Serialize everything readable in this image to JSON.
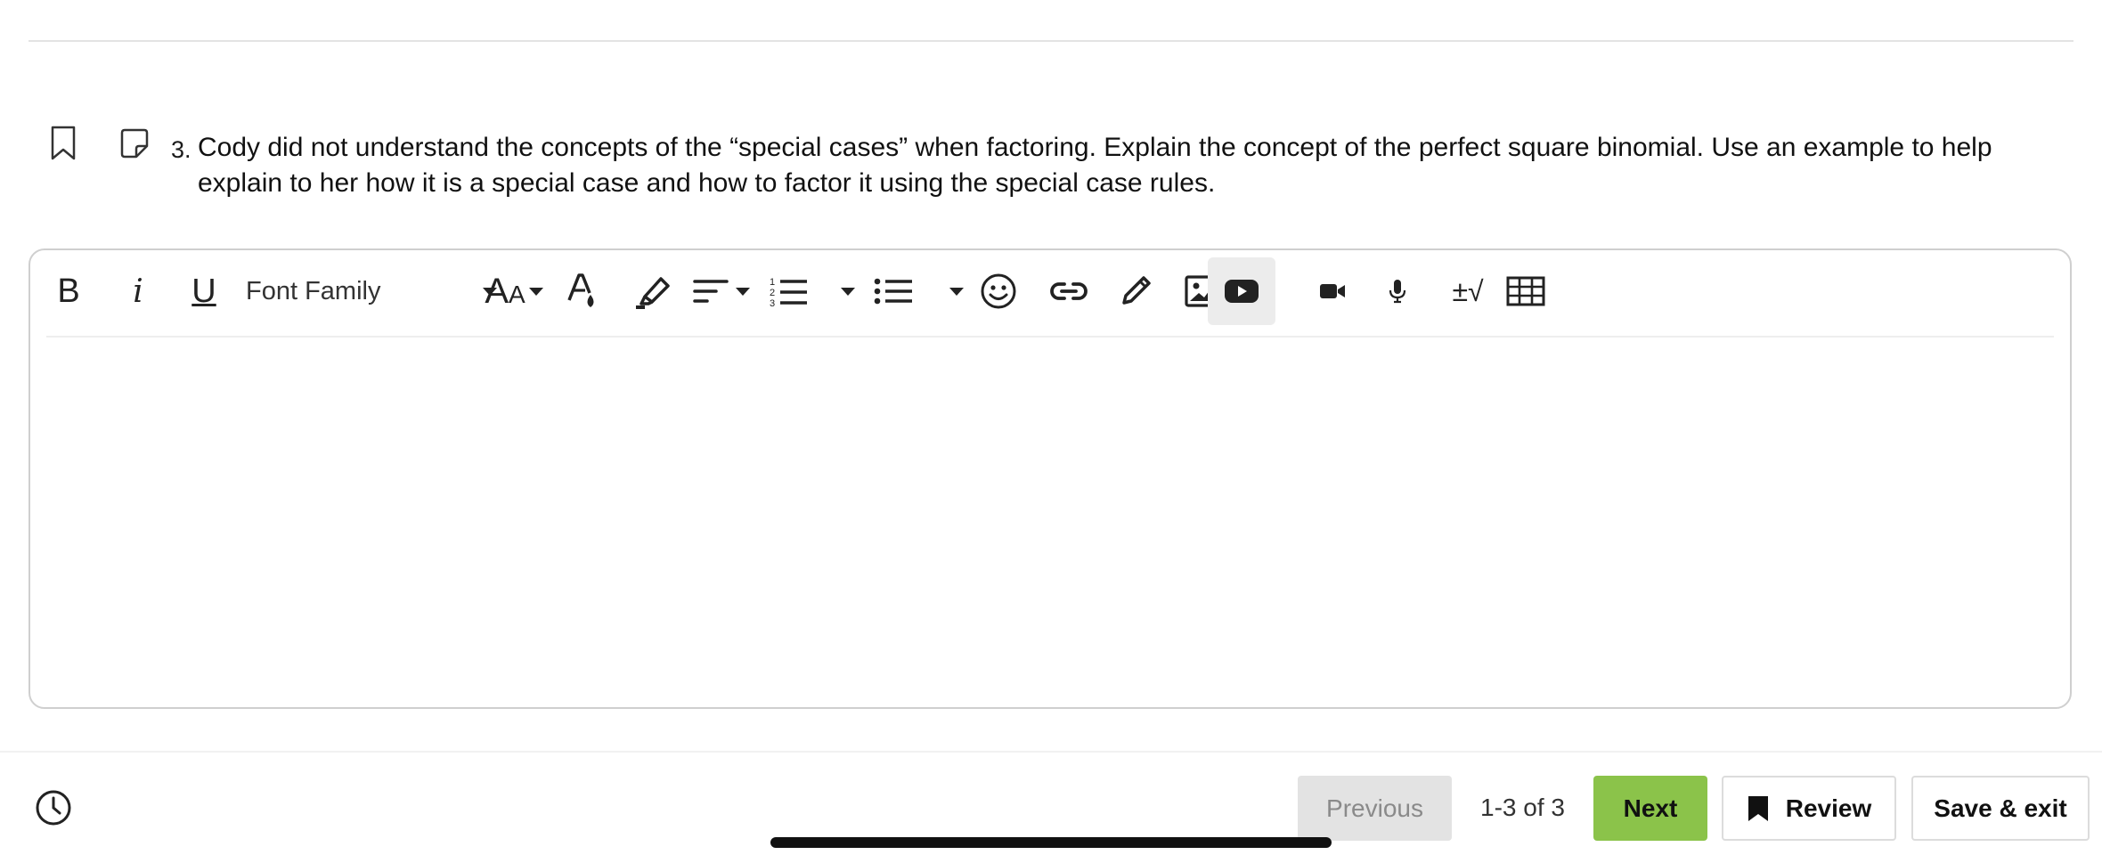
{
  "question": {
    "number": "3.",
    "text": "Cody did not understand the concepts of the “special cases” when factoring. Explain the concept of the perfect square binomial. Use an example to help explain to her how it is a special case and how to factor it using the special case rules."
  },
  "toolbar": {
    "bold": "B",
    "italic": "i",
    "underline": "U",
    "font_family": "Font Family",
    "font_size_big": "A",
    "font_size_small": "A",
    "math_symbol": "±√"
  },
  "editor": {
    "value": ""
  },
  "footer": {
    "previous_label": "Previous",
    "pager_text": "1-3 of 3",
    "next_label": "Next",
    "review_label": "Review",
    "save_exit_label": "Save & exit"
  },
  "colors": {
    "accent_green": "#8bc34a",
    "disabled_gray": "#e3e3e3",
    "border": "#cfcfcf"
  },
  "icons": [
    "bookmark-icon",
    "note-icon",
    "text-color-icon",
    "highlighter-icon",
    "align-icon",
    "numbered-list-icon",
    "bulleted-list-icon",
    "emoji-icon",
    "link-icon",
    "draw-icon",
    "image-icon",
    "youtube-icon",
    "video-icon",
    "microphone-icon",
    "equation-icon",
    "table-icon",
    "clock-icon"
  ]
}
